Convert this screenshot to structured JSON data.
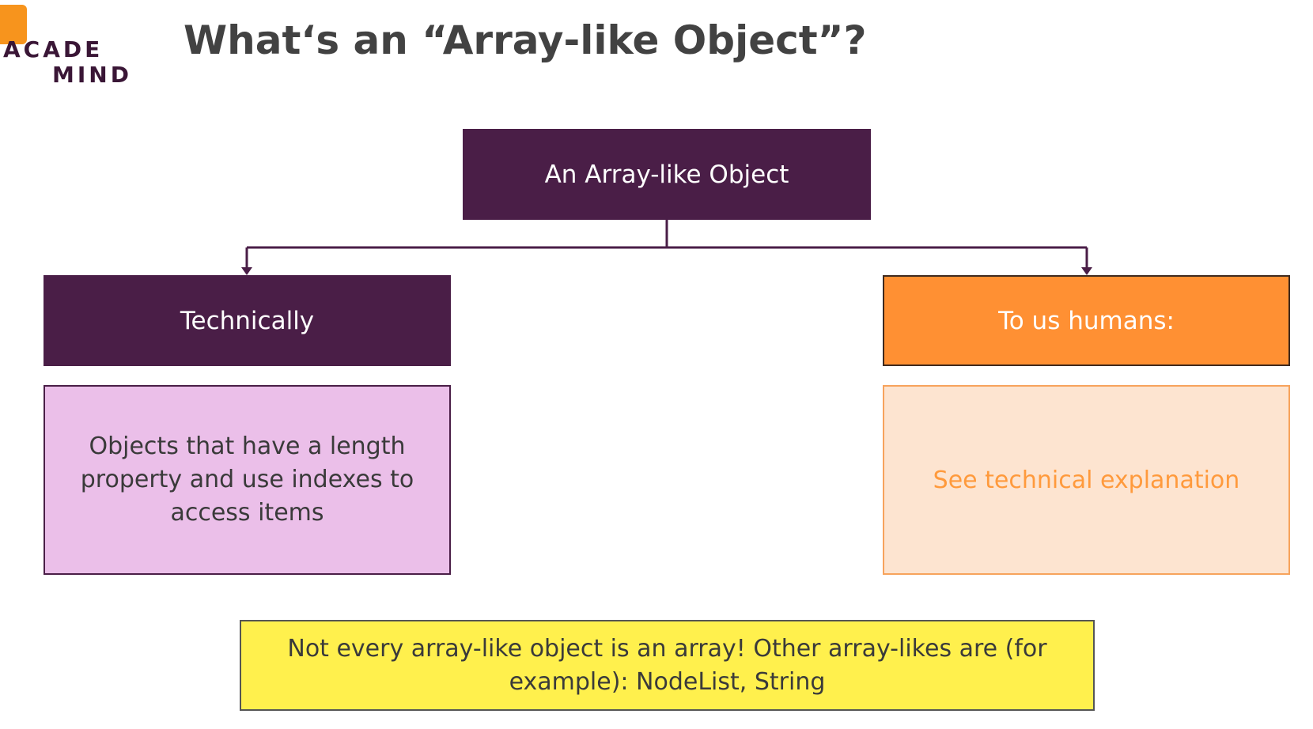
{
  "logo": {
    "line1": "ACADE",
    "line2": "MIND"
  },
  "title": "What‘s an “Array-like Object”?",
  "diagram": {
    "root": "An Array-like Object",
    "left_branch": {
      "header": "Technically",
      "body": "Objects that have a length property and use indexes to access items"
    },
    "right_branch": {
      "header": "To us humans:",
      "body": "See technical explanation"
    },
    "note": "Not every array-like object is an array! Other array-likes are (for example): NodeList, String"
  },
  "colors": {
    "primary_purple": "#4a1e47",
    "orange": "#ff9033",
    "light_pink": "#ebbfe9",
    "light_peach": "#fde4d0",
    "yellow": "#fff04d"
  }
}
